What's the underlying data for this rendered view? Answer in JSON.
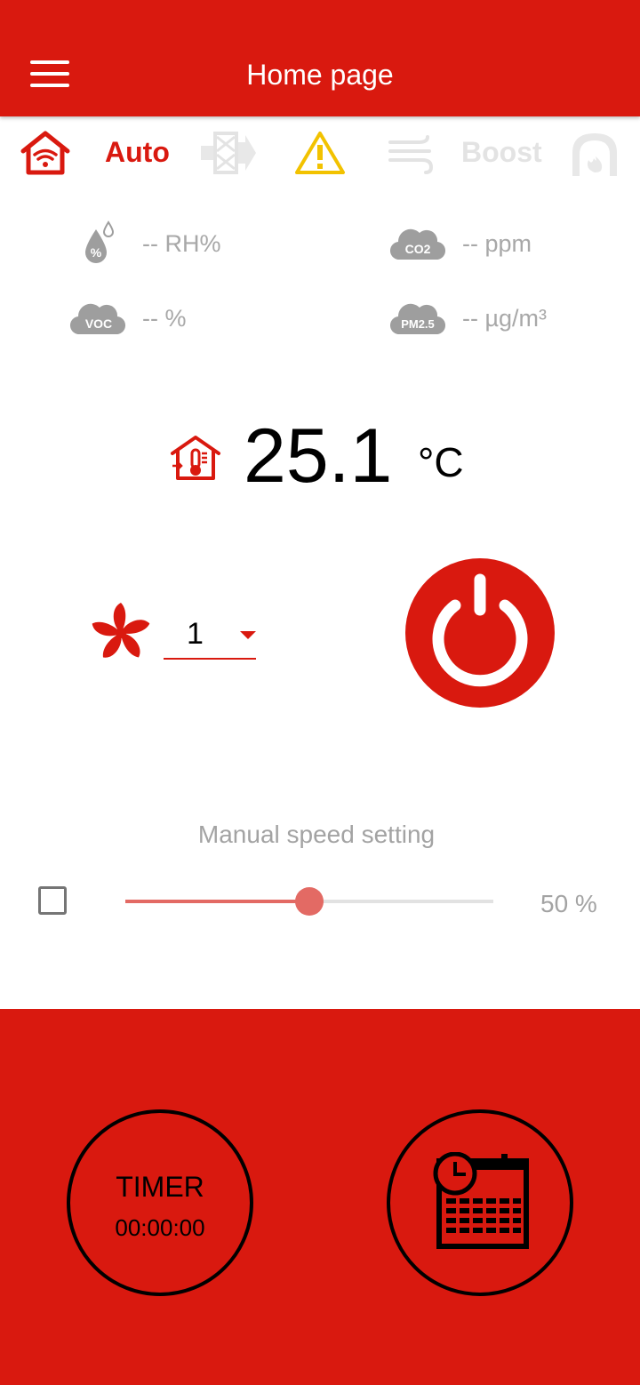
{
  "appbar": {
    "title": "Home page"
  },
  "modes": {
    "auto_label": "Auto",
    "boost_label": "Boost"
  },
  "sensors": {
    "humidity": "-- RH%",
    "co2": "-- ppm",
    "voc": "-- %",
    "pm25": "-- µg/m³",
    "co2_icon_text": "CO2",
    "voc_icon_text": "VOC",
    "pm25_icon_text": "PM2.5"
  },
  "temperature": {
    "value": "25.1",
    "unit": "°C"
  },
  "fan": {
    "speed": "1"
  },
  "manual_speed": {
    "label": "Manual speed setting",
    "percent": 50,
    "value_text": "50 %",
    "checked": false
  },
  "timer": {
    "label": "TIMER",
    "time": "00:00:00"
  },
  "colors": {
    "brand_red": "#d9190f",
    "warning_yellow": "#f2c200",
    "disabled_gray": "#e3e3e3",
    "slider_red": "#e36a64"
  },
  "icons": [
    "menu-icon",
    "home-wifi-icon",
    "filter-icon",
    "warning-icon",
    "wind-icon",
    "fireplace-icon",
    "humidity-icon",
    "co2-cloud-icon",
    "voc-cloud-icon",
    "pm25-cloud-icon",
    "thermometer-house-icon",
    "fan-icon",
    "power-icon",
    "calendar-clock-icon"
  ]
}
